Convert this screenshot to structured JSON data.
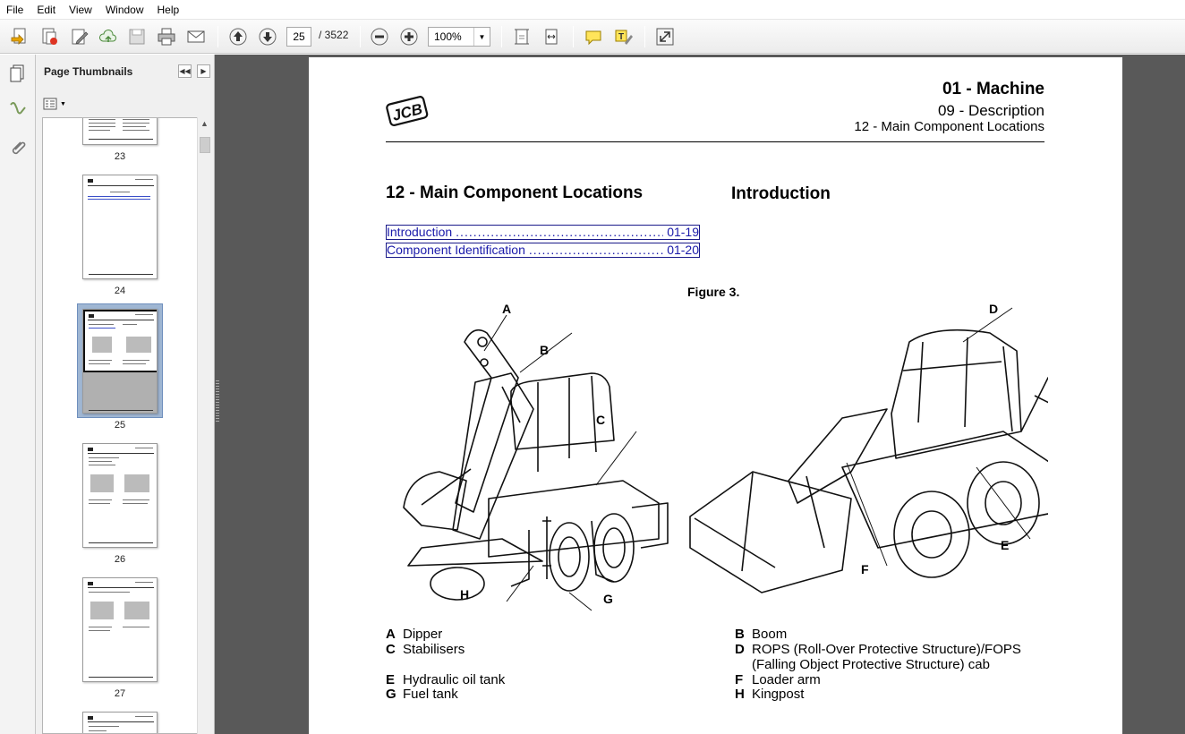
{
  "menu": [
    "File",
    "Edit",
    "View",
    "Window",
    "Help"
  ],
  "toolbar": {
    "page_current": "25",
    "page_total": "/  3522",
    "zoom": "100%"
  },
  "icons": {
    "toolbar": [
      "create-pdf-icon",
      "combine-files-icon",
      "edit-icon",
      "upload-cloud-icon",
      "save-icon",
      "print-icon",
      "email-icon",
      "previous-page-icon",
      "next-page-icon",
      "zoom-out-icon",
      "zoom-in-icon",
      "fit-page-icon",
      "fit-width-icon",
      "comment-icon",
      "highlight-icon",
      "expand-icon"
    ],
    "nav": [
      "page-thumbnails-icon",
      "signatures-icon",
      "attachments-icon"
    ]
  },
  "thumbnails_panel": {
    "title": "Page Thumbnails",
    "pages": [
      "23",
      "24",
      "25",
      "26",
      "27"
    ],
    "selected": "25"
  },
  "document": {
    "header": {
      "line1": "01 - Machine",
      "line2": "09 - Description",
      "line3": "12 - Main Component Locations"
    },
    "section_title": "12 - Main Component Locations",
    "intro_heading": "Introduction",
    "toc": [
      {
        "label": "Introduction",
        "dots": "......................................................",
        "page": "01-19"
      },
      {
        "label": "Component Identification",
        "dots": "................................",
        "page": "01-20"
      }
    ],
    "figure_caption": "Figure 3.",
    "callouts": [
      "A",
      "B",
      "C",
      "D",
      "E",
      "F",
      "G",
      "H"
    ],
    "legend": [
      {
        "key": "A",
        "text": "Dipper"
      },
      {
        "key": "B",
        "text": "Boom"
      },
      {
        "key": "C",
        "text": "Stabilisers"
      },
      {
        "key": "D",
        "text": "ROPS (Roll-Over Protective Structure)/FOPS"
      },
      {
        "key": "",
        "text": "(Falling Object Protective Structure) cab"
      },
      {
        "key": "E",
        "text": "Hydraulic oil tank"
      },
      {
        "key": "F",
        "text": "Loader arm"
      },
      {
        "key": "G",
        "text": "Fuel tank"
      },
      {
        "key": "H",
        "text": "Kingpost"
      }
    ],
    "logo_text": "JCB"
  },
  "colors": {
    "doc_background": "#595959",
    "link": "#1a1aaa",
    "selection": "#9fb6d3"
  }
}
